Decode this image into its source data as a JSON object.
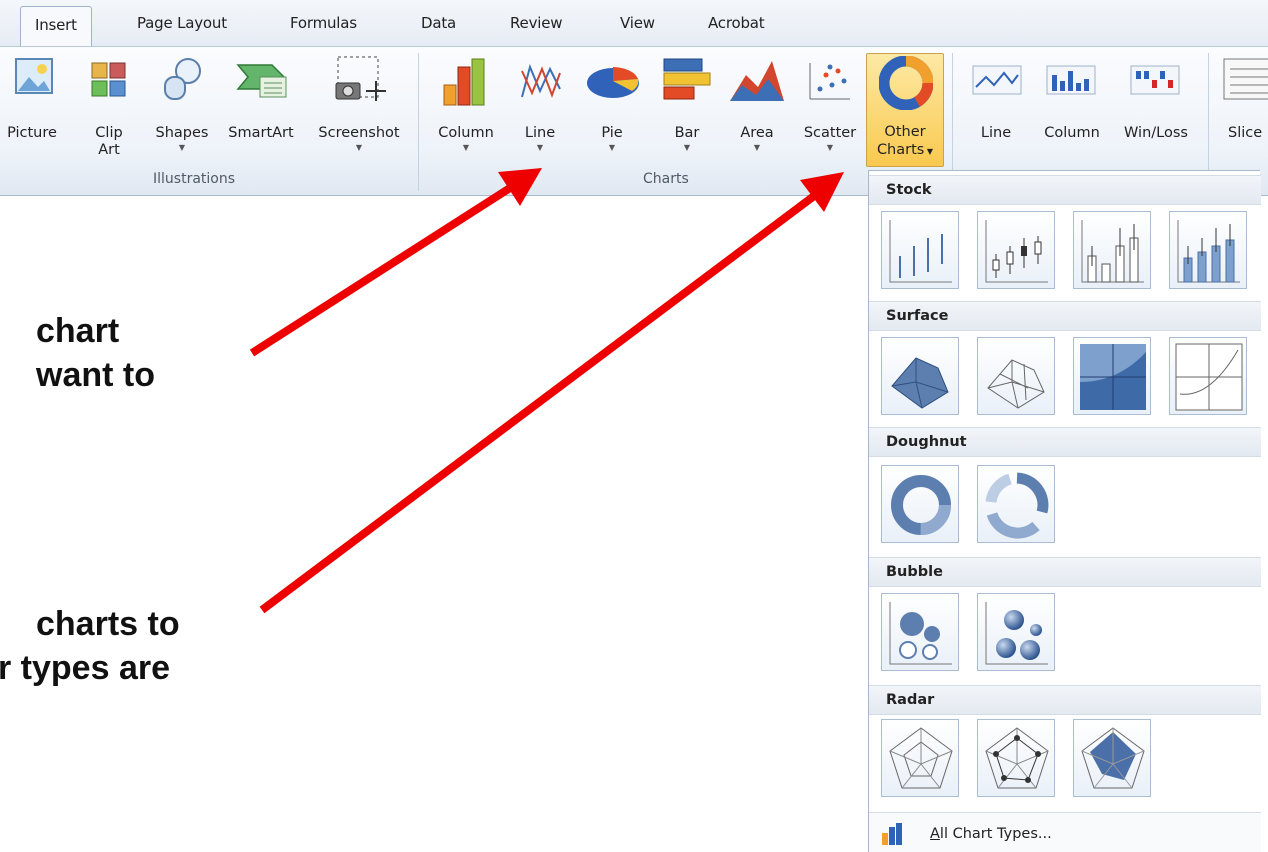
{
  "tabs": [
    "Insert",
    "Page Layout",
    "Formulas",
    "Data",
    "Review",
    "View",
    "Acrobat"
  ],
  "ribbon": {
    "illustrations": {
      "picture": "Picture",
      "clip_art": [
        "Clip",
        "Art"
      ],
      "shapes": "Shapes",
      "smartart": "SmartArt",
      "screenshot": "Screenshot",
      "group_label": "Illustrations"
    },
    "charts": {
      "column": "Column",
      "line": "Line",
      "pie": "Pie",
      "bar": "Bar",
      "area": "Area",
      "scatter": "Scatter",
      "other": [
        "Other",
        "Charts"
      ],
      "group_label": "Charts"
    },
    "sparklines": {
      "line": "Line",
      "column": "Column",
      "win_loss": "Win/Loss"
    },
    "slicer_partial": "Slice"
  },
  "annotations": {
    "line1a": "chart",
    "line1b": "want to",
    "line2a": "charts to",
    "line2b": "r types are"
  },
  "gallery": {
    "sections": [
      "Stock",
      "Surface",
      "Doughnut",
      "Bubble",
      "Radar"
    ],
    "all_types_prefix": "A",
    "all_types_rest": "ll Chart Types..."
  },
  "colors": {
    "arrow": "#ee0000",
    "highlight": "#f9c94f"
  }
}
